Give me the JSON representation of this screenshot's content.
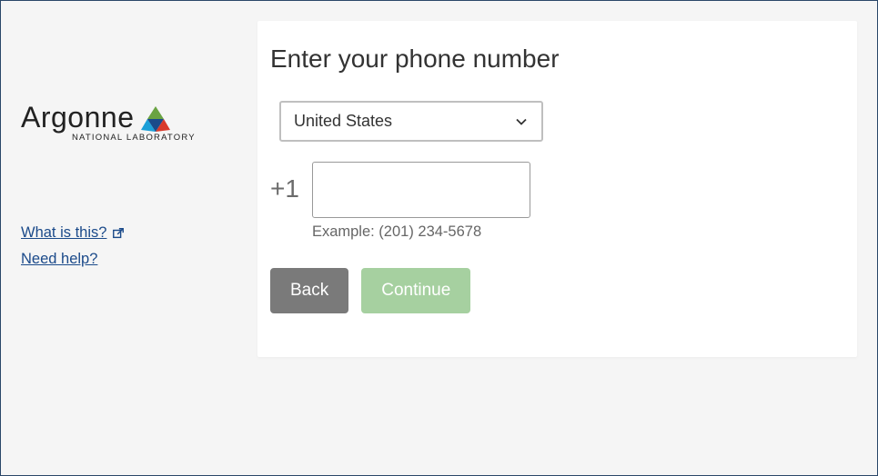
{
  "sidebar": {
    "logo": {
      "word": "Argonne",
      "subtitle": "NATIONAL LABORATORY"
    },
    "links": {
      "what_is_this": "What is this?",
      "need_help": "Need help?"
    }
  },
  "form": {
    "heading": "Enter your phone number",
    "country": {
      "selected": "United States"
    },
    "calling_code": "+1",
    "phone_value": "",
    "example_label": "Example: (201) 234-5678",
    "back_label": "Back",
    "continue_label": "Continue"
  }
}
